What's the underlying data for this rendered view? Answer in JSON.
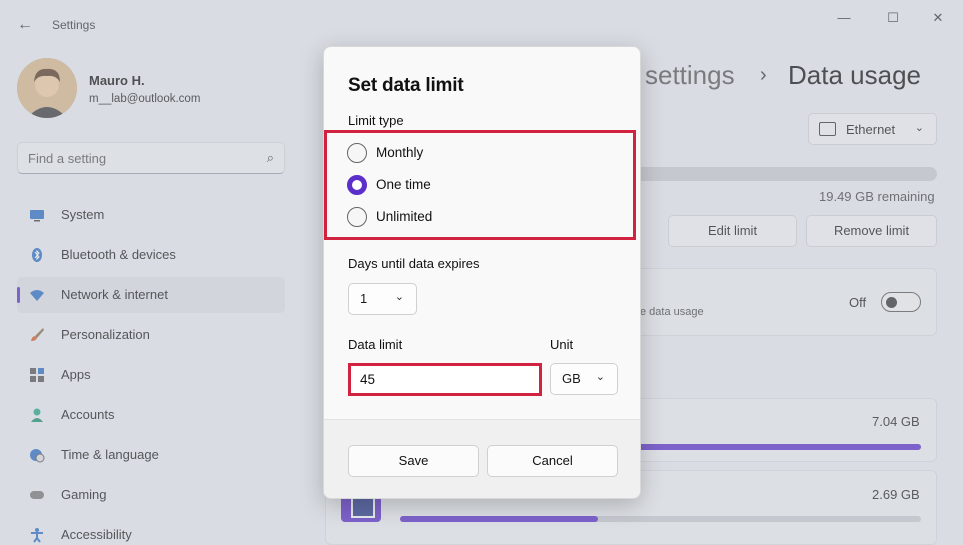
{
  "window": {
    "title": "Settings"
  },
  "user": {
    "name": "Mauro H.",
    "email": "m__lab@outlook.com"
  },
  "search": {
    "placeholder": "Find a setting"
  },
  "sidebar": {
    "items": [
      {
        "label": "System",
        "icon": "monitor-icon"
      },
      {
        "label": "Bluetooth & devices",
        "icon": "bluetooth-icon"
      },
      {
        "label": "Network & internet",
        "icon": "wifi-icon",
        "active": true
      },
      {
        "label": "Personalization",
        "icon": "brush-icon"
      },
      {
        "label": "Apps",
        "icon": "apps-icon"
      },
      {
        "label": "Accounts",
        "icon": "person-icon"
      },
      {
        "label": "Time & language",
        "icon": "globe-clock-icon"
      },
      {
        "label": "Gaming",
        "icon": "gamepad-icon"
      },
      {
        "label": "Accessibility",
        "icon": "accessibility-icon"
      }
    ]
  },
  "breadcrumb": {
    "parent": "settings",
    "separator": "›",
    "current": "Data usage"
  },
  "network": {
    "selected": "Ethernet"
  },
  "usage": {
    "remaining": "19.49 GB remaining"
  },
  "buttons": {
    "edit_limit": "Edit limit",
    "remove_limit": "Remove limit"
  },
  "restrict": {
    "description": "e data usage",
    "state": "Off",
    "enabled": false
  },
  "apps": [
    {
      "size": "7.04 GB",
      "fraction": 1.0
    },
    {
      "size": "2.69 GB",
      "fraction": 0.38
    }
  ],
  "dialog": {
    "title": "Set data limit",
    "limit_type_label": "Limit type",
    "options": [
      "Monthly",
      "One time",
      "Unlimited"
    ],
    "selected_option": "One time",
    "days_label": "Days until data expires",
    "days_value": "1",
    "data_limit_label": "Data limit",
    "data_limit_value": "45",
    "unit_label": "Unit",
    "unit_value": "GB",
    "save": "Save",
    "cancel": "Cancel"
  },
  "colors": {
    "accent": "#5b2fc9",
    "highlight": "#d1233f"
  }
}
